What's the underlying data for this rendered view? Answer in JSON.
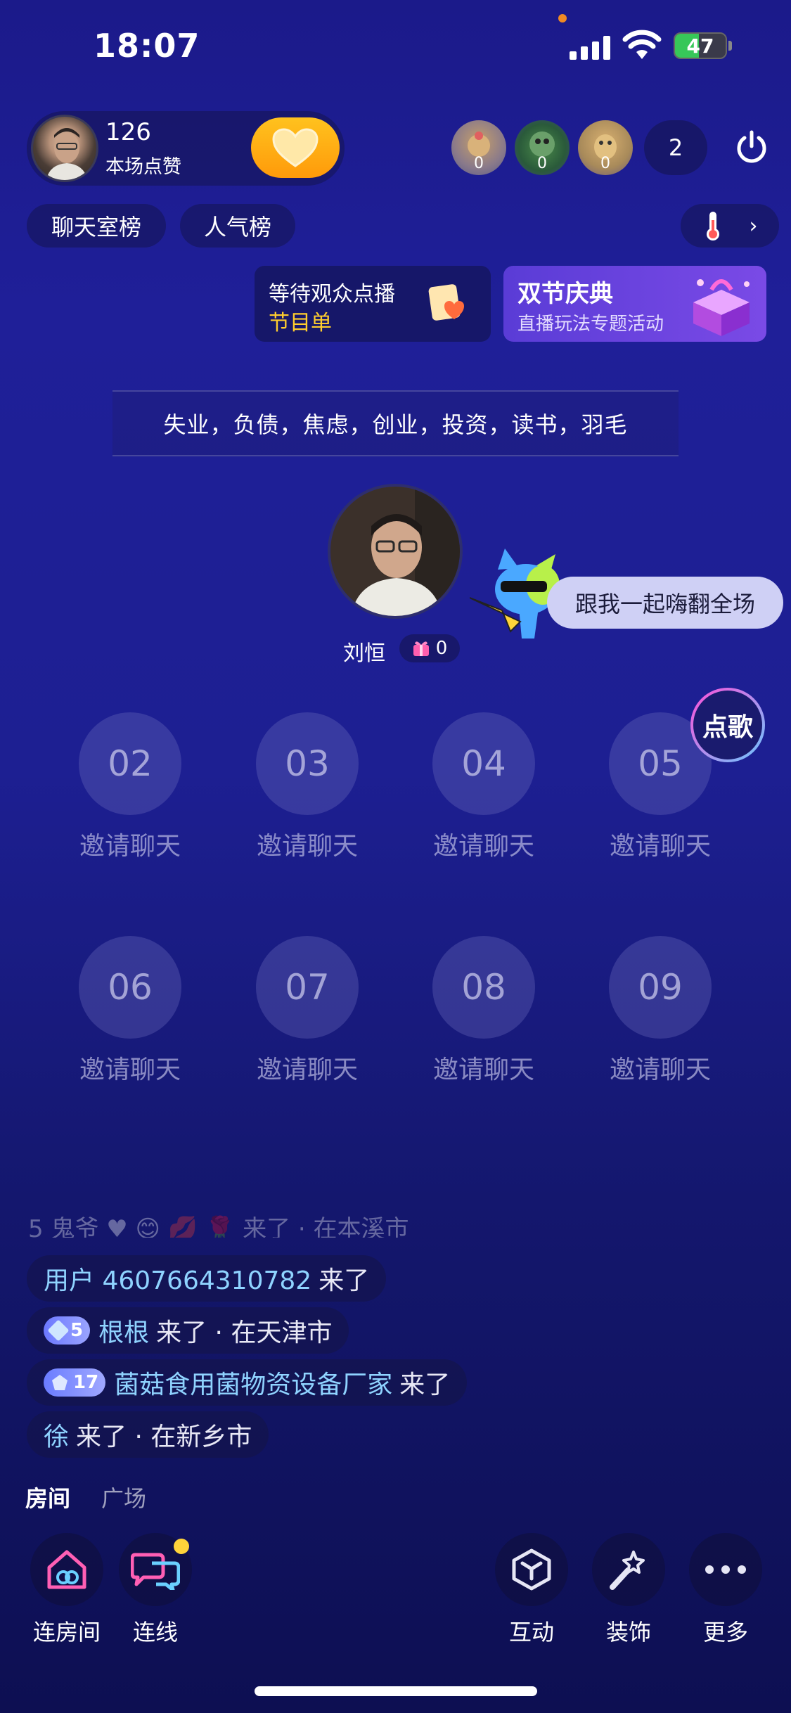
{
  "status": {
    "time": "18:07",
    "battery": "47",
    "battery_level": 0.47
  },
  "host": {
    "likes": "126",
    "likes_label": "本场点赞"
  },
  "viewers": [
    {
      "count": "0"
    },
    {
      "count": "0"
    },
    {
      "count": "0"
    }
  ],
  "online_count": "2",
  "ranks": {
    "chat_room": "聊天室榜",
    "popularity": "人气榜"
  },
  "song_card": {
    "title": "等待观众点播",
    "subtitle": "节目单"
  },
  "festival_card": {
    "title": "双节庆典",
    "subtitle": "直播玩法专题活动"
  },
  "topics": "失业，负债，焦虑，创业，投资，读书，羽毛",
  "anchor": {
    "name": "刘恒",
    "gifts": "0"
  },
  "mascot_bubble": "跟我一起嗨翻全场",
  "song_order_label": "点歌",
  "seats": [
    {
      "number": "02",
      "label": "邀请聊天"
    },
    {
      "number": "03",
      "label": "邀请聊天"
    },
    {
      "number": "04",
      "label": "邀请聊天"
    },
    {
      "number": "05",
      "label": "邀请聊天"
    },
    {
      "number": "06",
      "label": "邀请聊天"
    },
    {
      "number": "07",
      "label": "邀请聊天"
    },
    {
      "number": "08",
      "label": "邀请聊天"
    },
    {
      "number": "09",
      "label": "邀请聊天"
    }
  ],
  "chat": {
    "faded": "5  鬼爷 ♥ 😊 💋 🌹 来了 · 在本溪市",
    "messages": [
      {
        "level": "",
        "user": "用户 4607664310782",
        "text": "来了"
      },
      {
        "level": "5",
        "user": "根根",
        "text": "来了 · 在天津市"
      },
      {
        "level": "17",
        "user": "菌菇食用菌物资设备厂家",
        "text": "来了"
      },
      {
        "level": "",
        "user": "徐",
        "text": "来了 · 在新乡市"
      }
    ]
  },
  "tabs": {
    "room": "房间",
    "plaza": "广场"
  },
  "toolbar": {
    "link_room": "连房间",
    "link": "连线",
    "interact": "互动",
    "decorate": "装饰",
    "more": "更多"
  },
  "colors": {
    "accent_yellow": "#ffcd2e",
    "chat_user": "#8fd3ff",
    "festival": "#6a44e0"
  }
}
